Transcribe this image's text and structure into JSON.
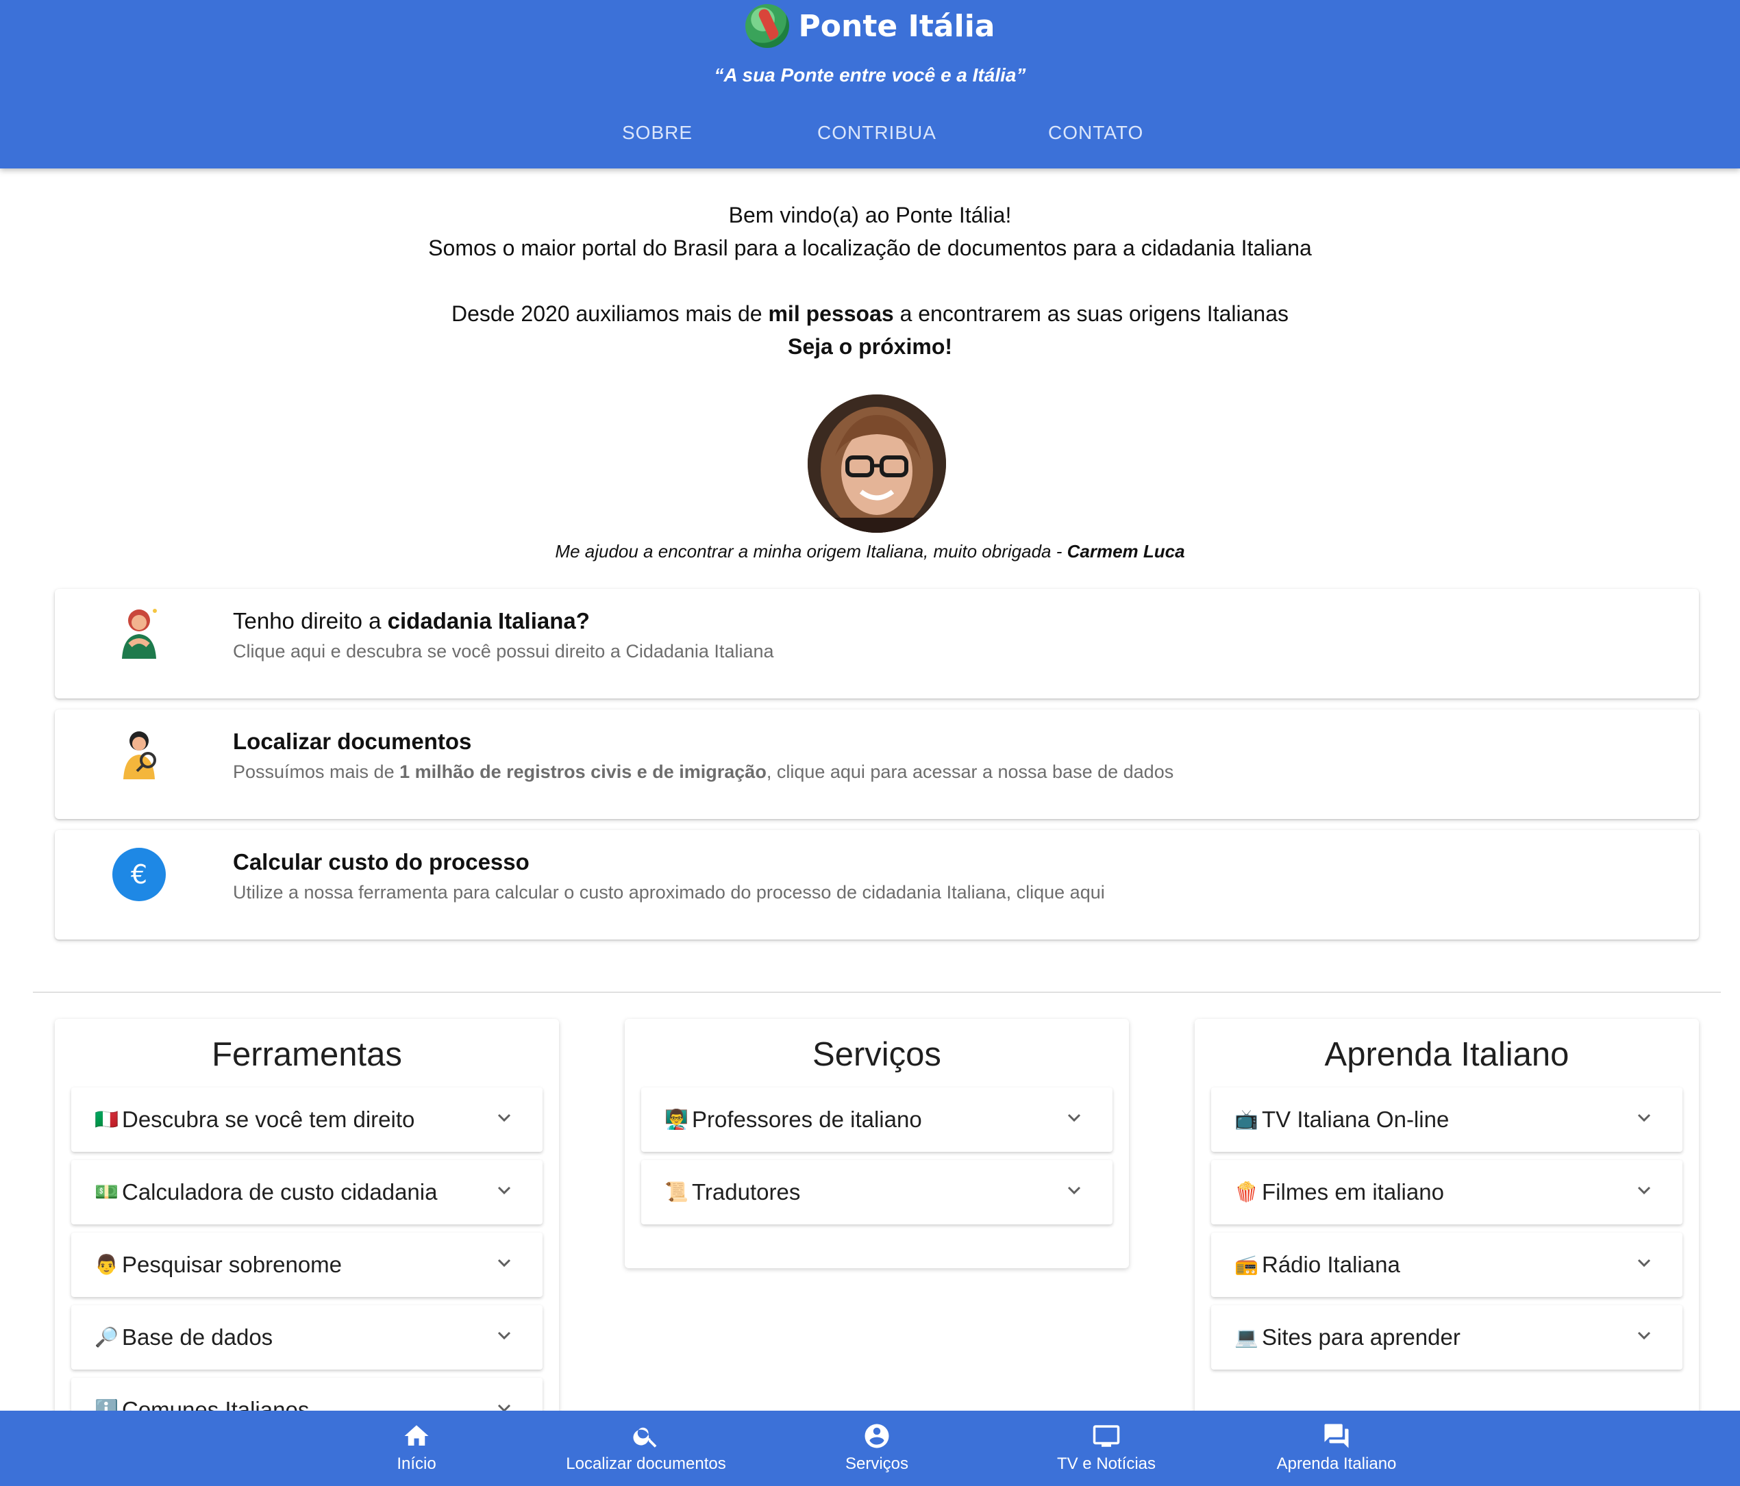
{
  "header": {
    "brand": "Ponte Itália",
    "tagline": "“A sua Ponte entre você e a Itália”",
    "nav": [
      "SOBRE",
      "CONTRIBUA",
      "CONTATO"
    ]
  },
  "welcome": {
    "line1": "Bem vindo(a) ao Ponte Itália!",
    "line2": "Somos o maior portal do Brasil para a localização de documentos para a cidadania Italiana",
    "line3_pre": "Desde 2020 auxiliamos mais de ",
    "line3_bold": "mil pessoas",
    "line3_post": " a encontrarem as suas origens Italianas",
    "line4": "Seja o próximo!"
  },
  "testimonial": {
    "quote": "Me ajudou a encontrar a minha origem Italiana, muito obrigada - ",
    "author": "Carmem Luca"
  },
  "cards": [
    {
      "title_pre": "Tenho direito a ",
      "title_bold": "cidadania Italiana?",
      "sub_pre": "Clique aqui e descubra se você possui direito a Cidadania Italiana",
      "sub_bold": "",
      "sub_post": ""
    },
    {
      "title_pre": "",
      "title_bold": "Localizar documentos",
      "sub_pre": "Possuímos mais de ",
      "sub_bold": "1 milhão de registros civis e de imigração",
      "sub_post": ", clique aqui para acessar a nossa base de dados"
    },
    {
      "title_pre": "",
      "title_bold": "Calcular custo do processo",
      "sub_pre": "Utilize a nossa ferramenta para calcular o custo aproximado do processo de cidadania Italiana, clique aqui",
      "sub_bold": "",
      "sub_post": "",
      "icon_glyph": "€"
    }
  ],
  "columns": [
    {
      "title": "Ferramentas",
      "items": [
        {
          "emoji": "🇮🇹",
          "label": "Descubra se você tem direito"
        },
        {
          "emoji": "💵",
          "label": "Calculadora de custo cidadania"
        },
        {
          "emoji": "👨",
          "label": "Pesquisar sobrenome"
        },
        {
          "emoji": "🔎",
          "label": "Base de dados"
        },
        {
          "emoji": "ℹ️",
          "label": "Comunes Italianos"
        }
      ]
    },
    {
      "title": "Serviços",
      "items": [
        {
          "emoji": "👨‍🏫",
          "label": "Professores de italiano"
        },
        {
          "emoji": "📜",
          "label": "Tradutores"
        }
      ]
    },
    {
      "title": "Aprenda Italiano",
      "items": [
        {
          "emoji": "📺",
          "label": "TV Italiana On-line"
        },
        {
          "emoji": "🍿",
          "label": "Filmes em italiano"
        },
        {
          "emoji": "📻",
          "label": "Rádio Italiana"
        },
        {
          "emoji": "💻",
          "label": "Sites para aprender"
        }
      ]
    }
  ],
  "bottom_nav": [
    {
      "label": "Início",
      "icon": "home-icon"
    },
    {
      "label": "Localizar documentos",
      "icon": "search-icon"
    },
    {
      "label": "Serviços",
      "icon": "account-circle-icon"
    },
    {
      "label": "TV e Notícias",
      "icon": "monitor-icon"
    },
    {
      "label": "Aprenda Italiano",
      "icon": "chat-icon"
    }
  ],
  "colors": {
    "primary": "#3c71d8",
    "muted_text": "#6d6d6d",
    "euro_icon": "#1e88e5"
  }
}
